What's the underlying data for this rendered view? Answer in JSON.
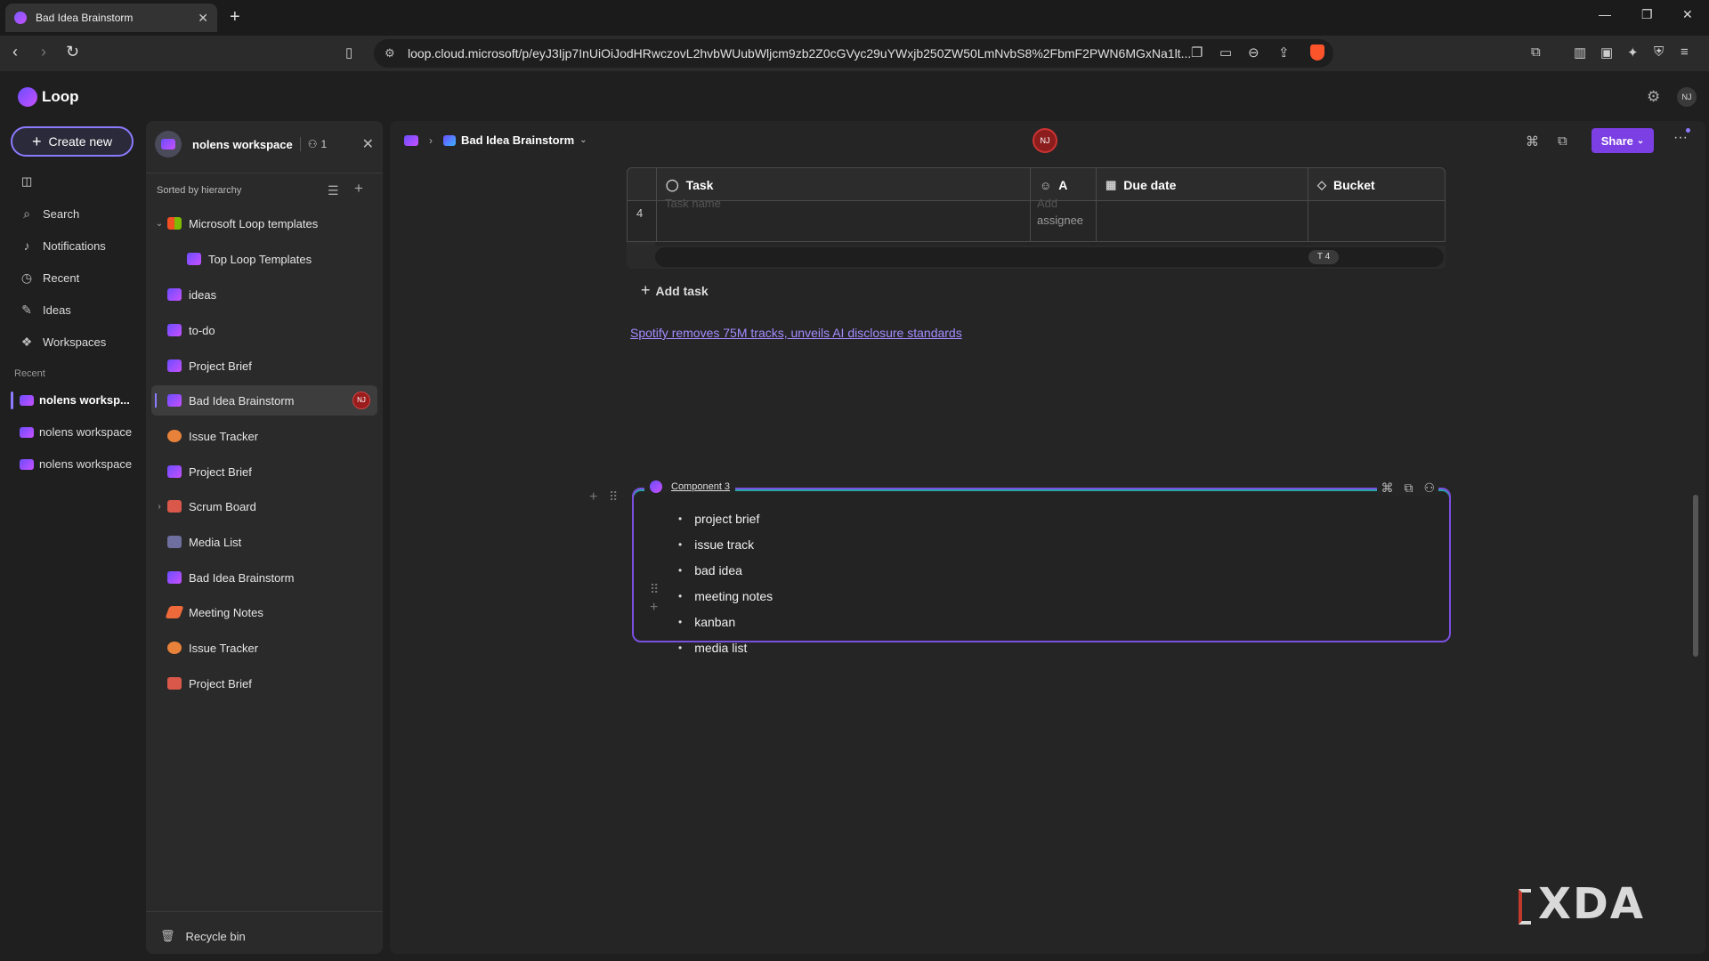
{
  "browser": {
    "tab_title": "Bad Idea Brainstorm",
    "tab_close": "✕",
    "new_tab": "+",
    "url": "loop.cloud.microsoft/p/eyJ3Ijp7InUiOiJodHRwczovL2hvbWUubWljcm9zb2Z0cGVyc29uYWxjb250ZW50LmNvbS8%2FbmF2PWN6MGxNa1lt..."
  },
  "app": {
    "name": "Loop",
    "user_initials": "NJ"
  },
  "leftnav": {
    "create_label": "Create new",
    "items": [
      {
        "label": "Search",
        "icon": "search-icon"
      },
      {
        "label": "Notifications",
        "icon": "bell-icon"
      },
      {
        "label": "Recent",
        "icon": "clock-icon"
      },
      {
        "label": "Ideas",
        "icon": "ideas-icon"
      },
      {
        "label": "Workspaces",
        "icon": "workspaces-icon"
      }
    ],
    "recent_label": "Recent",
    "recent": [
      "nolens worksp...",
      "nolens workspace",
      "nolens workspace"
    ]
  },
  "workspace": {
    "name": "nolens workspace",
    "members": "1",
    "sorted_label": "Sorted by hierarchy",
    "tree": [
      {
        "label": "Microsoft Loop templates",
        "chevron": "⌄"
      },
      {
        "label": "Top Loop Templates"
      },
      {
        "label": "ideas"
      },
      {
        "label": "to-do"
      },
      {
        "label": "Project Brief"
      },
      {
        "label": "Bad Idea Brainstorm",
        "badge": "NJ"
      },
      {
        "label": "Issue Tracker"
      },
      {
        "label": "Project Brief"
      },
      {
        "label": "Scrum Board",
        "chevron": "›"
      },
      {
        "label": "Media List"
      },
      {
        "label": "Bad Idea Brainstorm"
      },
      {
        "label": "Meeting Notes"
      },
      {
        "label": "Issue Tracker"
      },
      {
        "label": "Project Brief"
      }
    ],
    "recycle_label": "Recycle bin"
  },
  "page": {
    "breadcrumb_title": "Bad Idea Brainstorm",
    "presence_initials": "NJ",
    "share_label": "Share",
    "table": {
      "columns": [
        "Task",
        "A",
        "Due date",
        "Bucket"
      ],
      "row_number": "4",
      "task_placeholder": "Task name",
      "assignee_placeholder_1": "Add",
      "assignee_placeholder_2": "assignee",
      "footer_count": "T 4"
    },
    "add_task_label": "Add task",
    "link_text": "Spotify removes 75M tracks, unveils AI disclosure standards",
    "component": {
      "title": "Component 3",
      "items": [
        "project brief",
        "issue track",
        "bad idea",
        "meeting notes",
        "kanban",
        "media list"
      ]
    }
  },
  "watermark": "XDA",
  "colors": {
    "accent": "#7b3fe4",
    "link": "#a58cff",
    "avatar_red": "#8c1d1d"
  }
}
